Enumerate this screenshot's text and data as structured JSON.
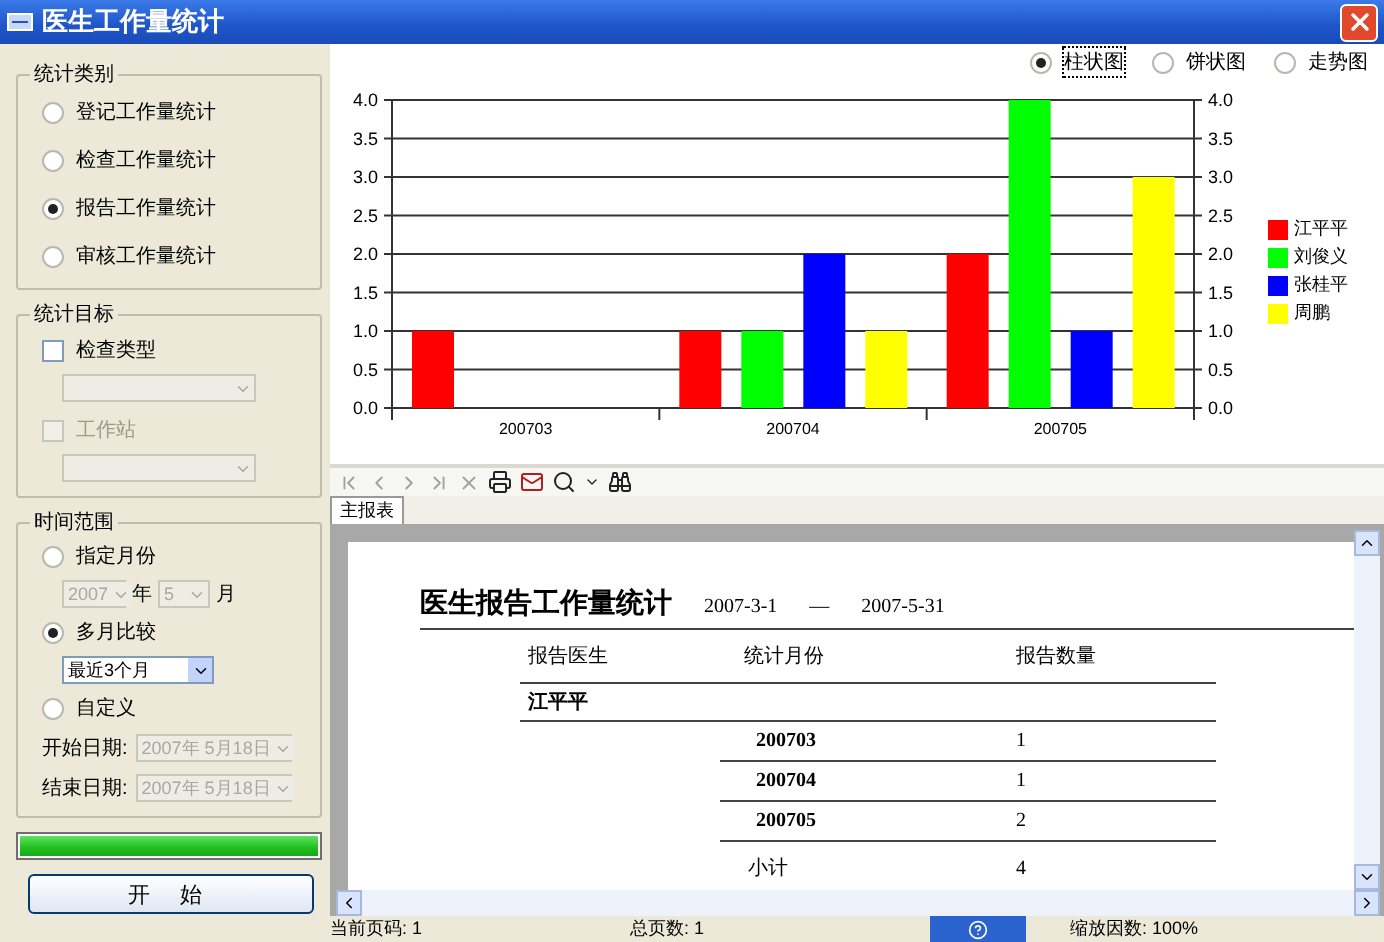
{
  "window": {
    "title": "医生工作量统计"
  },
  "stat_type": {
    "title": "统计类别",
    "options": [
      {
        "label": "登记工作量统计",
        "selected": false
      },
      {
        "label": "检查工作量统计",
        "selected": false
      },
      {
        "label": "报告工作量统计",
        "selected": true
      },
      {
        "label": "审核工作量统计",
        "selected": false
      }
    ]
  },
  "stat_target": {
    "title": "统计目标",
    "items": [
      {
        "label": "检查类型",
        "checked": false,
        "disabled": false
      },
      {
        "label": "工作站",
        "checked": false,
        "disabled": true
      }
    ]
  },
  "time_range": {
    "title": "时间范围",
    "month_option": {
      "label": "指定月份",
      "selected": false,
      "year": "2007",
      "year_suffix": "年",
      "month": "5",
      "month_suffix": "月"
    },
    "multi_option": {
      "label": "多月比较",
      "selected": true,
      "range": "最近3个月"
    },
    "custom_option": {
      "label": "自定义",
      "selected": false,
      "start_label": "开始日期:",
      "start_value": "2007年 5月18日",
      "end_label": "结束日期:",
      "end_value": "2007年 5月18日"
    }
  },
  "progress": {
    "level": 1
  },
  "start_button": {
    "label": "开 始"
  },
  "chart_types": [
    {
      "label": "柱状图",
      "selected": true
    },
    {
      "label": "饼状图",
      "selected": false
    },
    {
      "label": "走势图",
      "selected": false
    }
  ],
  "chart": {
    "chart_data": {
      "type": "bar",
      "categories": [
        "200703",
        "200704",
        "200705"
      ],
      "series": [
        {
          "name": "江平平",
          "color": "#ff0000",
          "values": [
            1,
            1,
            2
          ]
        },
        {
          "name": "刘俊义",
          "color": "#00ff00",
          "values": [
            0,
            1,
            4
          ]
        },
        {
          "name": "张桂平",
          "color": "#0000ff",
          "values": [
            0,
            2,
            1
          ]
        },
        {
          "name": "周鹏",
          "color": "#ffff00",
          "values": [
            0,
            1,
            3
          ]
        }
      ],
      "ylim": [
        0,
        4
      ],
      "grid": true,
      "yticks": [
        {
          "value": 0,
          "label": "0.0"
        },
        {
          "value": 0.5,
          "label": "0.5"
        },
        {
          "value": 1,
          "label": "1.0"
        },
        {
          "value": 1.5,
          "label": "1.5"
        },
        {
          "value": 2,
          "label": "2.0"
        },
        {
          "value": 2.5,
          "label": "2.5"
        },
        {
          "value": 3,
          "label": "3.0"
        },
        {
          "value": 3.5,
          "label": "3.5"
        },
        {
          "value": 4,
          "label": "4.0"
        }
      ]
    }
  },
  "viewer_tab": {
    "label": "主报表",
    "selected": true
  },
  "report": {
    "title": "医生报告工作量统计",
    "date_from": "2007-3-1",
    "dash": "—",
    "date_to": "2007-5-31",
    "columns": [
      "报告医生",
      "统计月份",
      "报告数量"
    ],
    "groups": [
      {
        "doctor": "江平平",
        "rows": [
          {
            "month": "200703",
            "count": "1"
          },
          {
            "month": "200704",
            "count": "1"
          },
          {
            "month": "200705",
            "count": "2"
          }
        ],
        "subtotal_label": "小计",
        "subtotal": "4"
      }
    ]
  },
  "status_bar": [
    {
      "label": "当前页码:",
      "value": "1"
    },
    {
      "label": "总页数:",
      "value": "1"
    },
    {
      "label": "缩放因数:",
      "value": "100%"
    }
  ]
}
